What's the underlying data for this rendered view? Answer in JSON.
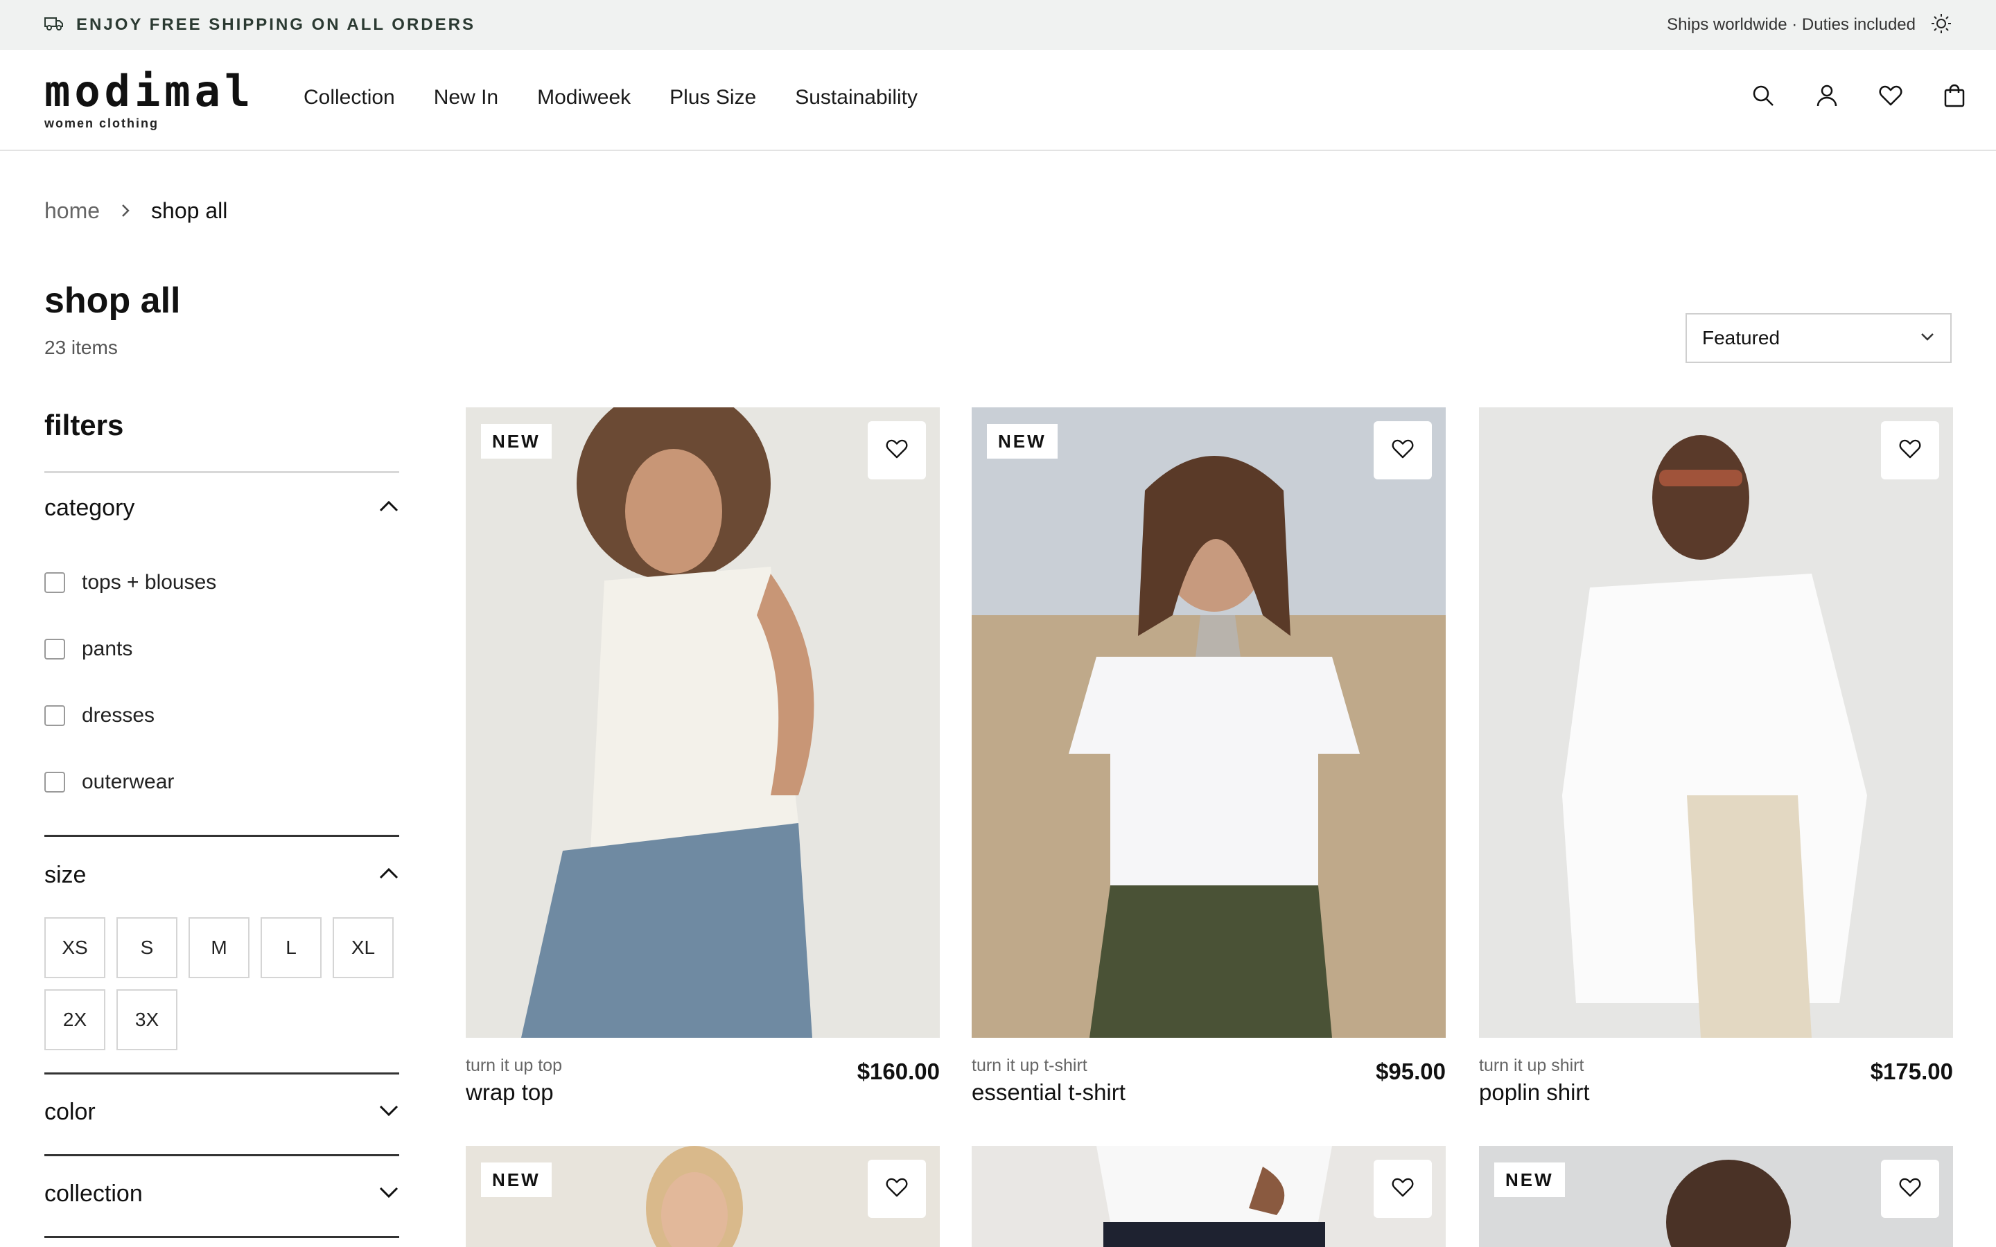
{
  "announcement": {
    "left_text": "ENJOY FREE SHIPPING ON ALL ORDERS",
    "right_text": "Ships worldwide · Duties included",
    "left_icon": "truck-icon",
    "right_icon": "sun-icon"
  },
  "header": {
    "logo": "modimal",
    "logo_sub": "women clothing",
    "nav": [
      "Collection",
      "New In",
      "Modiweek",
      "Plus Size",
      "Sustainability"
    ],
    "icons": [
      "search-icon",
      "user-icon",
      "heart-icon",
      "bag-icon"
    ]
  },
  "breadcrumb": {
    "home": "home",
    "current": "shop all"
  },
  "page": {
    "title": "shop all",
    "count": "23 items"
  },
  "sort": {
    "selected": "Featured"
  },
  "filters": {
    "title": "filters",
    "category": {
      "label": "category",
      "options": [
        "tops + blouses",
        "pants",
        "dresses",
        "outerwear"
      ]
    },
    "size": {
      "label": "size",
      "options": [
        "XS",
        "S",
        "M",
        "L",
        "XL",
        "2X",
        "3X"
      ]
    },
    "color": {
      "label": "color"
    },
    "collection": {
      "label": "collection"
    }
  },
  "products": [
    {
      "badge": "NEW",
      "sub": "turn it up top",
      "name": "wrap top",
      "price": "$160.00"
    },
    {
      "badge": "NEW",
      "sub": "turn it up t-shirt",
      "name": "essential t-shirt",
      "price": "$95.00"
    },
    {
      "badge": "",
      "sub": "turn it up shirt",
      "name": "poplin shirt",
      "price": "$175.00"
    },
    {
      "badge": "NEW"
    },
    {
      "badge": ""
    },
    {
      "badge": "NEW"
    }
  ],
  "colors": {
    "announce_bg": "#f0f2f1",
    "accent_text": "#2b3a32"
  }
}
